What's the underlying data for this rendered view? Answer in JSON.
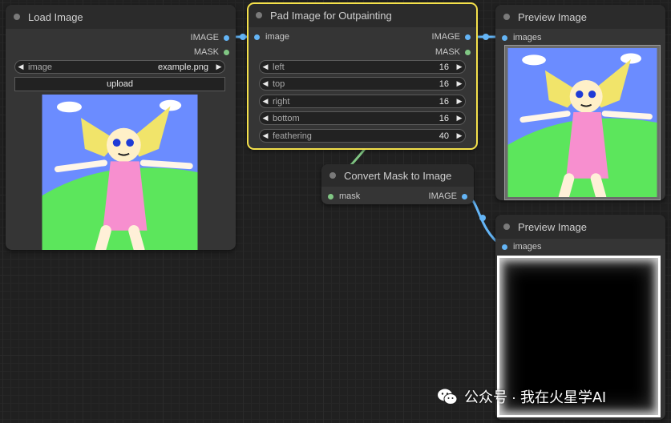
{
  "nodes": {
    "load_image": {
      "title": "Load Image",
      "outputs": [
        "IMAGE",
        "MASK"
      ],
      "widget_label": "image",
      "widget_value": "example.png",
      "upload_label": "upload"
    },
    "pad_image": {
      "title": "Pad Image for Outpainting",
      "input": "image",
      "outputs": [
        "IMAGE",
        "MASK"
      ],
      "widgets": [
        {
          "label": "left",
          "value": "16"
        },
        {
          "label": "top",
          "value": "16"
        },
        {
          "label": "right",
          "value": "16"
        },
        {
          "label": "bottom",
          "value": "16"
        },
        {
          "label": "feathering",
          "value": "40"
        }
      ]
    },
    "preview_1": {
      "title": "Preview Image",
      "input": "images"
    },
    "convert_mask": {
      "title": "Convert Mask to Image",
      "input": "mask",
      "output": "IMAGE"
    },
    "preview_2": {
      "title": "Preview Image",
      "input": "images"
    }
  },
  "watermark": {
    "icon": "wechat-icon",
    "text": "公众号 · 我在火星学AI"
  },
  "colors": {
    "canvas": "#202020",
    "node": "#353535",
    "selected": "#f5e14b",
    "image_link": "#64b5f6",
    "mask_link": "#81c784"
  }
}
